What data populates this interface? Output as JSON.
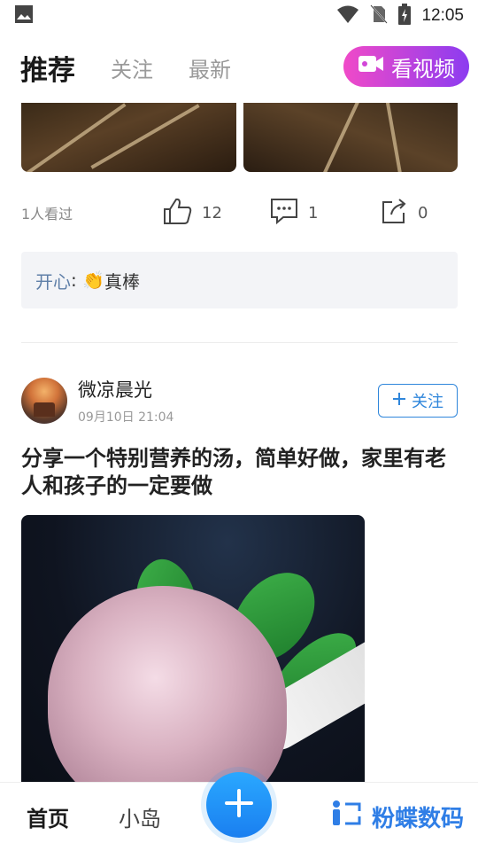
{
  "status_bar": {
    "time": "12:05",
    "icons": [
      "image-icon",
      "wifi-icon",
      "no-sim-icon",
      "battery-charging-icon"
    ]
  },
  "topnav": {
    "tabs": [
      {
        "label": "推荐",
        "active": true
      },
      {
        "label": "关注",
        "active": false
      },
      {
        "label": "最新",
        "active": false
      }
    ],
    "video_button_label": "看视频",
    "accent": "#1e88e5"
  },
  "feed": {
    "prev_post": {
      "views": "1人看过",
      "likes": "12",
      "comments": "1",
      "shares": "0",
      "comment": {
        "user": "开心",
        "emoji": "👏",
        "text": "真棒"
      }
    },
    "post": {
      "author": "微凉晨光",
      "time": "09月10日 21:04",
      "follow_label": "关注",
      "title": "分享一个特别营养的汤，简单好做，家里有老人和孩子的一定要做"
    }
  },
  "bottom_nav": {
    "home": "首页",
    "island": "小岛",
    "watermark": "粉蝶数码"
  }
}
